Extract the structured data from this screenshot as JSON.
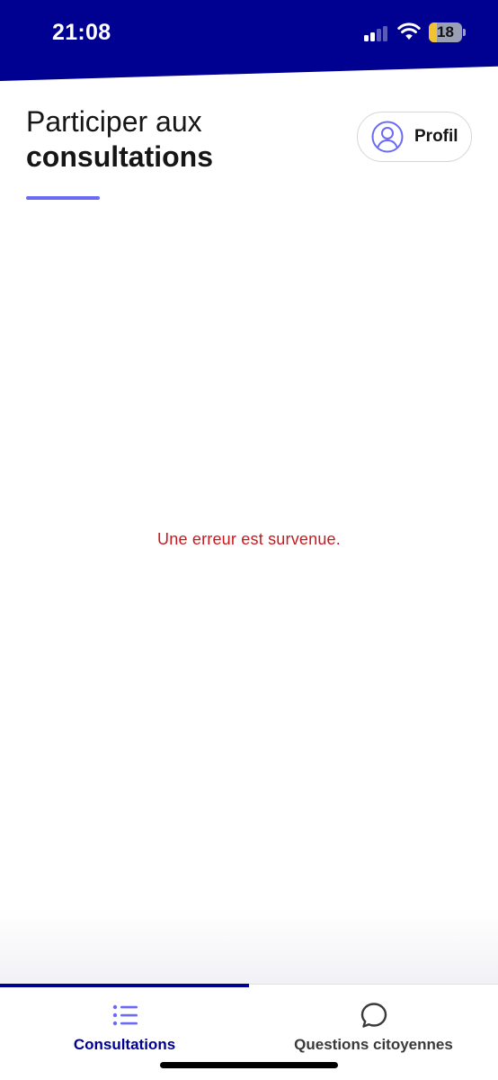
{
  "status_bar": {
    "time": "21:08",
    "battery_level": "18",
    "background_color": "#000091"
  },
  "header": {
    "title_line1": "Participer aux",
    "title_line2": "consultations",
    "underline_color": "#6a6af4",
    "profile_button_label": "Profil",
    "profile_icon": "user-circle-icon"
  },
  "main": {
    "error_message": "Une erreur est survenue.",
    "error_color": "#c9191e"
  },
  "tab_bar": {
    "tabs": [
      {
        "label": "Consultations",
        "icon": "list-icon",
        "active": true
      },
      {
        "label": "Questions citoyennes",
        "icon": "speech-bubble-icon",
        "active": false
      }
    ],
    "active_color": "#000091"
  }
}
